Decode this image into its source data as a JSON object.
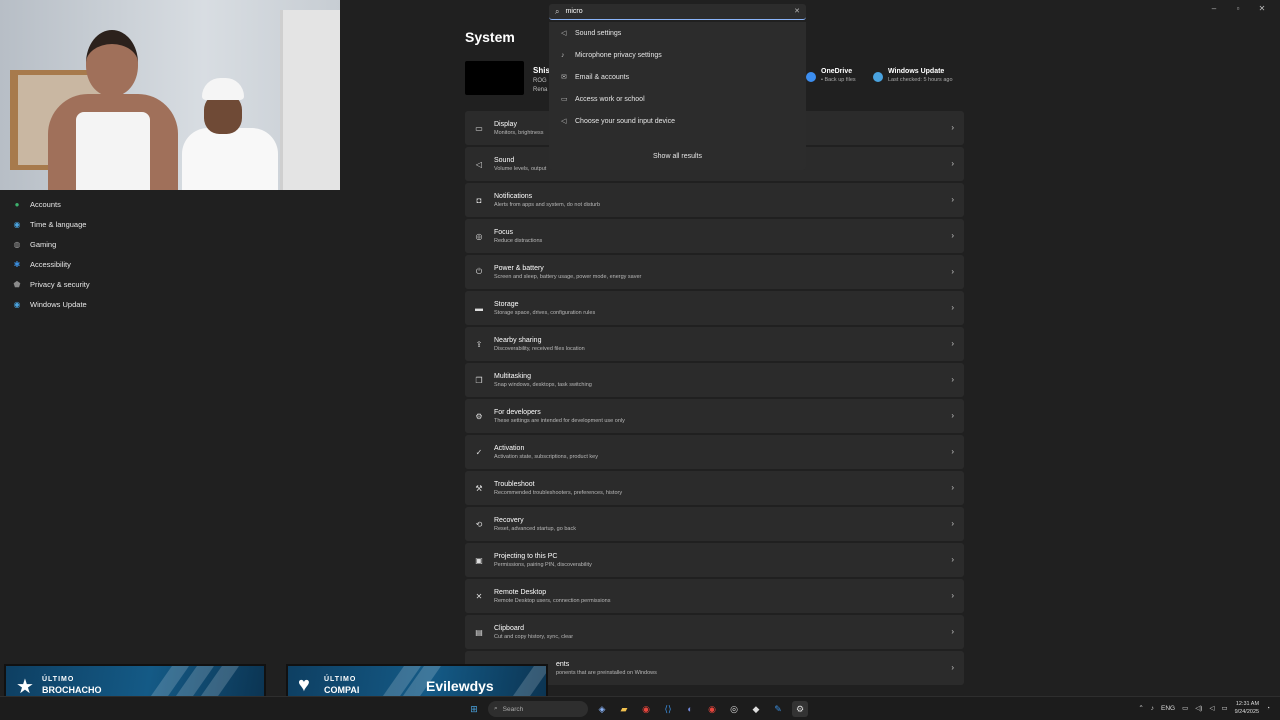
{
  "window": {
    "title": "System",
    "controls": [
      "minimize",
      "maximize",
      "close"
    ]
  },
  "device": {
    "name": "Shis",
    "model": "ROG",
    "rename": "Rena"
  },
  "quick_links": [
    {
      "title": "OneDrive",
      "sub": "• Back up files",
      "icon": "cloud-icon",
      "color": "#3c8ef0"
    },
    {
      "title": "Windows Update",
      "sub": "Last checked: 5 hours ago",
      "icon": "update-icon",
      "color": "#4aa3df"
    }
  ],
  "search": {
    "value": "micro",
    "results": [
      {
        "label": "Sound settings",
        "icon": "speaker-icon"
      },
      {
        "label": "Microphone privacy settings",
        "icon": "microphone-icon"
      },
      {
        "label": "Email & accounts",
        "icon": "mail-icon"
      },
      {
        "label": "Access work or school",
        "icon": "briefcase-icon"
      },
      {
        "label": "Choose your sound input device",
        "icon": "speaker-icon"
      }
    ],
    "show_all": "Show all results"
  },
  "sidebar": {
    "items": [
      {
        "label": "Accounts",
        "icon": "person-icon",
        "color": "#3db06c"
      },
      {
        "label": "Time & language",
        "icon": "globe-clock-icon",
        "color": "#4aa3df"
      },
      {
        "label": "Gaming",
        "icon": "gamepad-icon",
        "color": "#9a9a9a"
      },
      {
        "label": "Accessibility",
        "icon": "accessibility-icon",
        "color": "#3b8fe0"
      },
      {
        "label": "Privacy & security",
        "icon": "shield-icon",
        "color": "#8b8b8b"
      },
      {
        "label": "Windows Update",
        "icon": "update-icon",
        "color": "#4aa3df"
      }
    ]
  },
  "settings": [
    {
      "title": "Display",
      "sub": "Monitors, brightness",
      "icon": "monitor-icon"
    },
    {
      "title": "Sound",
      "sub": "Volume levels, output",
      "icon": "speaker-icon"
    },
    {
      "title": "Notifications",
      "sub": "Alerts from apps and system, do not disturb",
      "icon": "bell-icon"
    },
    {
      "title": "Focus",
      "sub": "Reduce distractions",
      "icon": "focus-icon"
    },
    {
      "title": "Power & battery",
      "sub": "Screen and sleep, battery usage, power mode, energy saver",
      "icon": "power-icon"
    },
    {
      "title": "Storage",
      "sub": "Storage space, drives, configuration rules",
      "icon": "storage-icon"
    },
    {
      "title": "Nearby sharing",
      "sub": "Discoverability, received files location",
      "icon": "share-icon"
    },
    {
      "title": "Multitasking",
      "sub": "Snap windows, desktops, task switching",
      "icon": "multitask-icon"
    },
    {
      "title": "For developers",
      "sub": "These settings are intended for development use only",
      "icon": "developer-icon"
    },
    {
      "title": "Activation",
      "sub": "Activation state, subscriptions, product key",
      "icon": "check-circle-icon"
    },
    {
      "title": "Troubleshoot",
      "sub": "Recommended troubleshooters, preferences, history",
      "icon": "wrench-icon"
    },
    {
      "title": "Recovery",
      "sub": "Reset, advanced startup, go back",
      "icon": "recovery-icon"
    },
    {
      "title": "Projecting to this PC",
      "sub": "Permissions, pairing PIN, discoverability",
      "icon": "projector-icon"
    },
    {
      "title": "Remote Desktop",
      "sub": "Remote Desktop users, connection permissions",
      "icon": "remote-icon"
    },
    {
      "title": "Clipboard",
      "sub": "Cut and copy history, sync, clear",
      "icon": "clipboard-icon"
    },
    {
      "title": "ents",
      "sub": "ponents that are preinstalled on Windows",
      "icon": "components-icon"
    }
  ],
  "overlays": [
    {
      "small": "ÚLTIMO",
      "big": "BROCHACHO",
      "name": "",
      "icon": "star-icon"
    },
    {
      "small": "ÚLTIMO",
      "big": "COMPAI",
      "name": "Evilewdys",
      "icon": "heart-icon"
    }
  ],
  "taskbar": {
    "search_placeholder": "Search",
    "language": "ENG",
    "time": "12:31 AM",
    "date": "9/24/2025",
    "apps": [
      "start-icon",
      "files-icon",
      "explorer-icon",
      "chrome-icon",
      "vscode-icon",
      "discord-icon",
      "chrome-alt-icon",
      "steam-icon",
      "epic-icon",
      "notepad-icon",
      "settings-icon"
    ]
  }
}
